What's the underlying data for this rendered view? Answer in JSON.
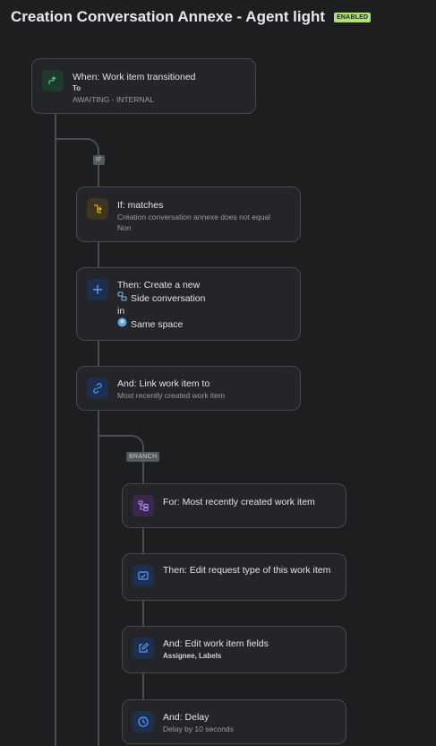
{
  "header": {
    "title": "Creation Conversation Annexe - Agent light",
    "status_badge": "ENABLED"
  },
  "tags": {
    "if": "IF",
    "branch": "BRANCH"
  },
  "trigger": {
    "title": "When: Work item transitioned",
    "to_label": "To",
    "status": "AWAITING - INTERNAL",
    "icon": "transition-icon"
  },
  "condition": {
    "title": "If: matches",
    "line1": "Création conversation annexe does not equal",
    "line2": "Non",
    "icon": "branch-condition-icon"
  },
  "create": {
    "title": "Then: Create a new",
    "item_type": "Side conversation",
    "in_label": "in",
    "space": "Same space",
    "icon": "plus-icon"
  },
  "link": {
    "title": "And: Link work item to",
    "detail": "Most recently created work item",
    "icon": "link-icon"
  },
  "branch_for": {
    "title": "For: Most recently created work item",
    "icon": "branch-icon"
  },
  "edit_request": {
    "title": "Then: Edit request type of this work item",
    "icon": "request-type-icon"
  },
  "edit_fields": {
    "title": "And: Edit work item fields",
    "detail": "Assignee, Labels",
    "icon": "edit-icon"
  },
  "delay": {
    "title": "And: Delay",
    "detail": "Delay by 10 seconds",
    "icon": "clock-icon"
  }
}
